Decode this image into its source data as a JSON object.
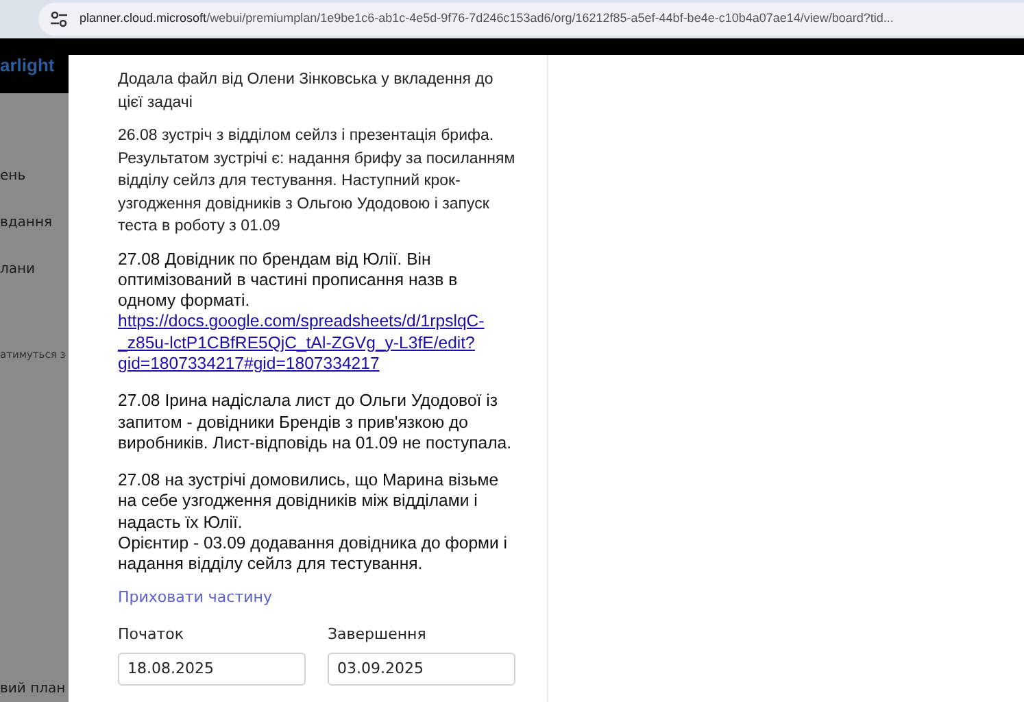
{
  "address_bar": {
    "domain": "planner.cloud.microsoft",
    "path": "/webui/premiumplan/1e9be1c6-ab1c-4e5d-9f76-7d246c153ad6/org/16212f85-a5ef-44bf-be4e-c10b4a07ae14/view/board?tid..."
  },
  "app_logo": "arlight",
  "sidebar": {
    "items": [
      {
        "label": "ень",
        "kind": "nav"
      },
      {
        "label": "вдання",
        "kind": "nav"
      },
      {
        "label": "лани",
        "kind": "nav"
      },
      {
        "label": "атимуться з",
        "kind": "hint"
      },
      {
        "label": "вий план",
        "kind": "nav"
      }
    ]
  },
  "notes": {
    "blocks": [
      {
        "kind": "plain",
        "lines": [
          "Додала файл від Олени Зінковська у вкладення до цієї задачі"
        ]
      },
      {
        "kind": "plain",
        "lines": [
          "26.08 зустріч з відділом сейлз і презентація брифа. Результатом зустрічі є: надання брифу за посиланням відділу сейлз для тестування. Наступний крок- узгодження довідників з Ольгою Удодовою і запуск теста в роботу з 01.09"
        ]
      },
      {
        "kind": "pasted",
        "lines": [
          "27.08 Довідник по брендам від Юлії. Він оптимізований в частині прописання назв в одному форматі."
        ],
        "link": "https://docs.google.com/spreadsheets/d/1rpslqC-_z85u-lctP1CBfRE5QjC_tAl-ZGVg_y-L3fE/edit?gid=1807334217#gid=1807334217"
      },
      {
        "kind": "pasted",
        "lines": [
          "27.08 Ірина надіслала лист до Ольги Удодової із запитом - довідники Брендів з прив'язкою до виробників. Лист-відповідь на 01.09 не поступала."
        ]
      },
      {
        "kind": "pasted",
        "lines": [
          "27.08 на зустрічі домовились, що Марина візьме на себе узгодження довідників між відділами і надасть їх Юлії.",
          "Орієнтир - 03.09 додавання довідника до форми і надання відділу сейлз для тестування."
        ]
      }
    ],
    "toggle": "Приховати частину"
  },
  "dates": [
    {
      "label": "Початок",
      "value": "18.08.2025"
    },
    {
      "label": "Завершення",
      "value": "03.09.2025"
    }
  ]
}
